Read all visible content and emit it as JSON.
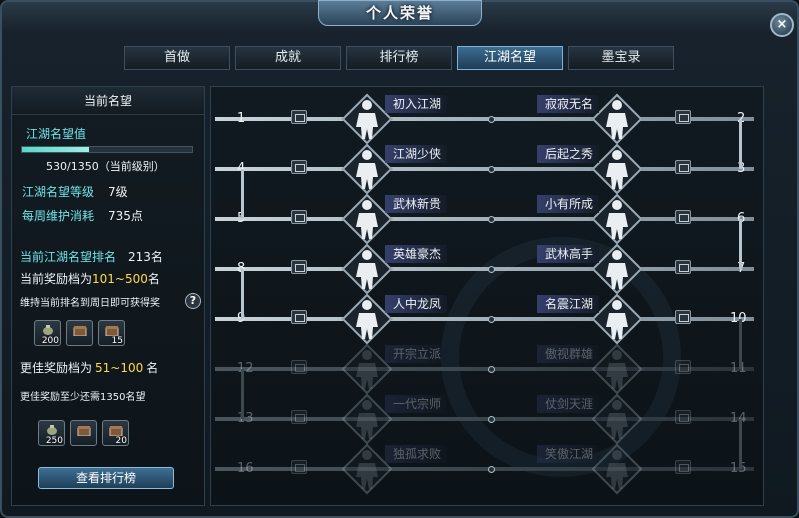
{
  "window": {
    "title": "个人荣誉",
    "close_label": "×"
  },
  "tabs": [
    {
      "label": "首做",
      "active": false
    },
    {
      "label": "成就",
      "active": false
    },
    {
      "label": "排行榜",
      "active": false
    },
    {
      "label": "江湖名望",
      "active": true
    },
    {
      "label": "墨宝录",
      "active": false
    }
  ],
  "left": {
    "header": "当前名望",
    "rep_label": "江湖名望值",
    "rep_progress": 0.392,
    "rep_value": "530/1350（当前级别）",
    "level_label": "江湖名望等级",
    "level_value": "7级",
    "upkeep_label": "每周维护消耗",
    "upkeep_value": "735点",
    "rank_label": "当前江湖名望排名",
    "rank_value": "213名",
    "tier_prefix": "当前奖励档为",
    "tier_value": "101~500",
    "tier_suffix": "名",
    "keep_note": "维持当前排名到周日即可获得奖",
    "help": "?",
    "rewards_current": [
      "200",
      "",
      "15"
    ],
    "better_prefix": "更佳奖励档为",
    "better_value": "51~100",
    "better_suffix": "名",
    "better_note": "更佳奖励至少还需1350名望",
    "rewards_better": [
      "250",
      "",
      "20"
    ],
    "rank_button": "查看排行榜"
  },
  "titles": [
    {
      "num": "1",
      "name": "初入江湖",
      "achieved": true
    },
    {
      "num": "2",
      "name": "寂寂无名",
      "achieved": true
    },
    {
      "num": "3",
      "name": "后起之秀",
      "achieved": true
    },
    {
      "num": "4",
      "name": "江湖少侠",
      "achieved": true
    },
    {
      "num": "5",
      "name": "武林新贵",
      "achieved": true
    },
    {
      "num": "6",
      "name": "小有所成",
      "achieved": true
    },
    {
      "num": "7",
      "name": "武林高手",
      "achieved": true
    },
    {
      "num": "8",
      "name": "英雄豪杰",
      "achieved": true
    },
    {
      "num": "9",
      "name": "人中龙凤",
      "achieved": true
    },
    {
      "num": "10",
      "name": "名震江湖",
      "achieved": true
    },
    {
      "num": "11",
      "name": "傲视群雄",
      "achieved": false
    },
    {
      "num": "12",
      "name": "开宗立派",
      "achieved": false
    },
    {
      "num": "13",
      "name": "一代宗师",
      "achieved": false
    },
    {
      "num": "14",
      "name": "仗剑天涯",
      "achieved": false
    },
    {
      "num": "15",
      "name": "笑傲江湖",
      "achieved": false
    },
    {
      "num": "16",
      "name": "独孤求败",
      "achieved": false
    }
  ],
  "colors": {
    "accent": "#6fe3e6",
    "highlight": "#ffd94a",
    "active_tab": "#3c6d90"
  }
}
